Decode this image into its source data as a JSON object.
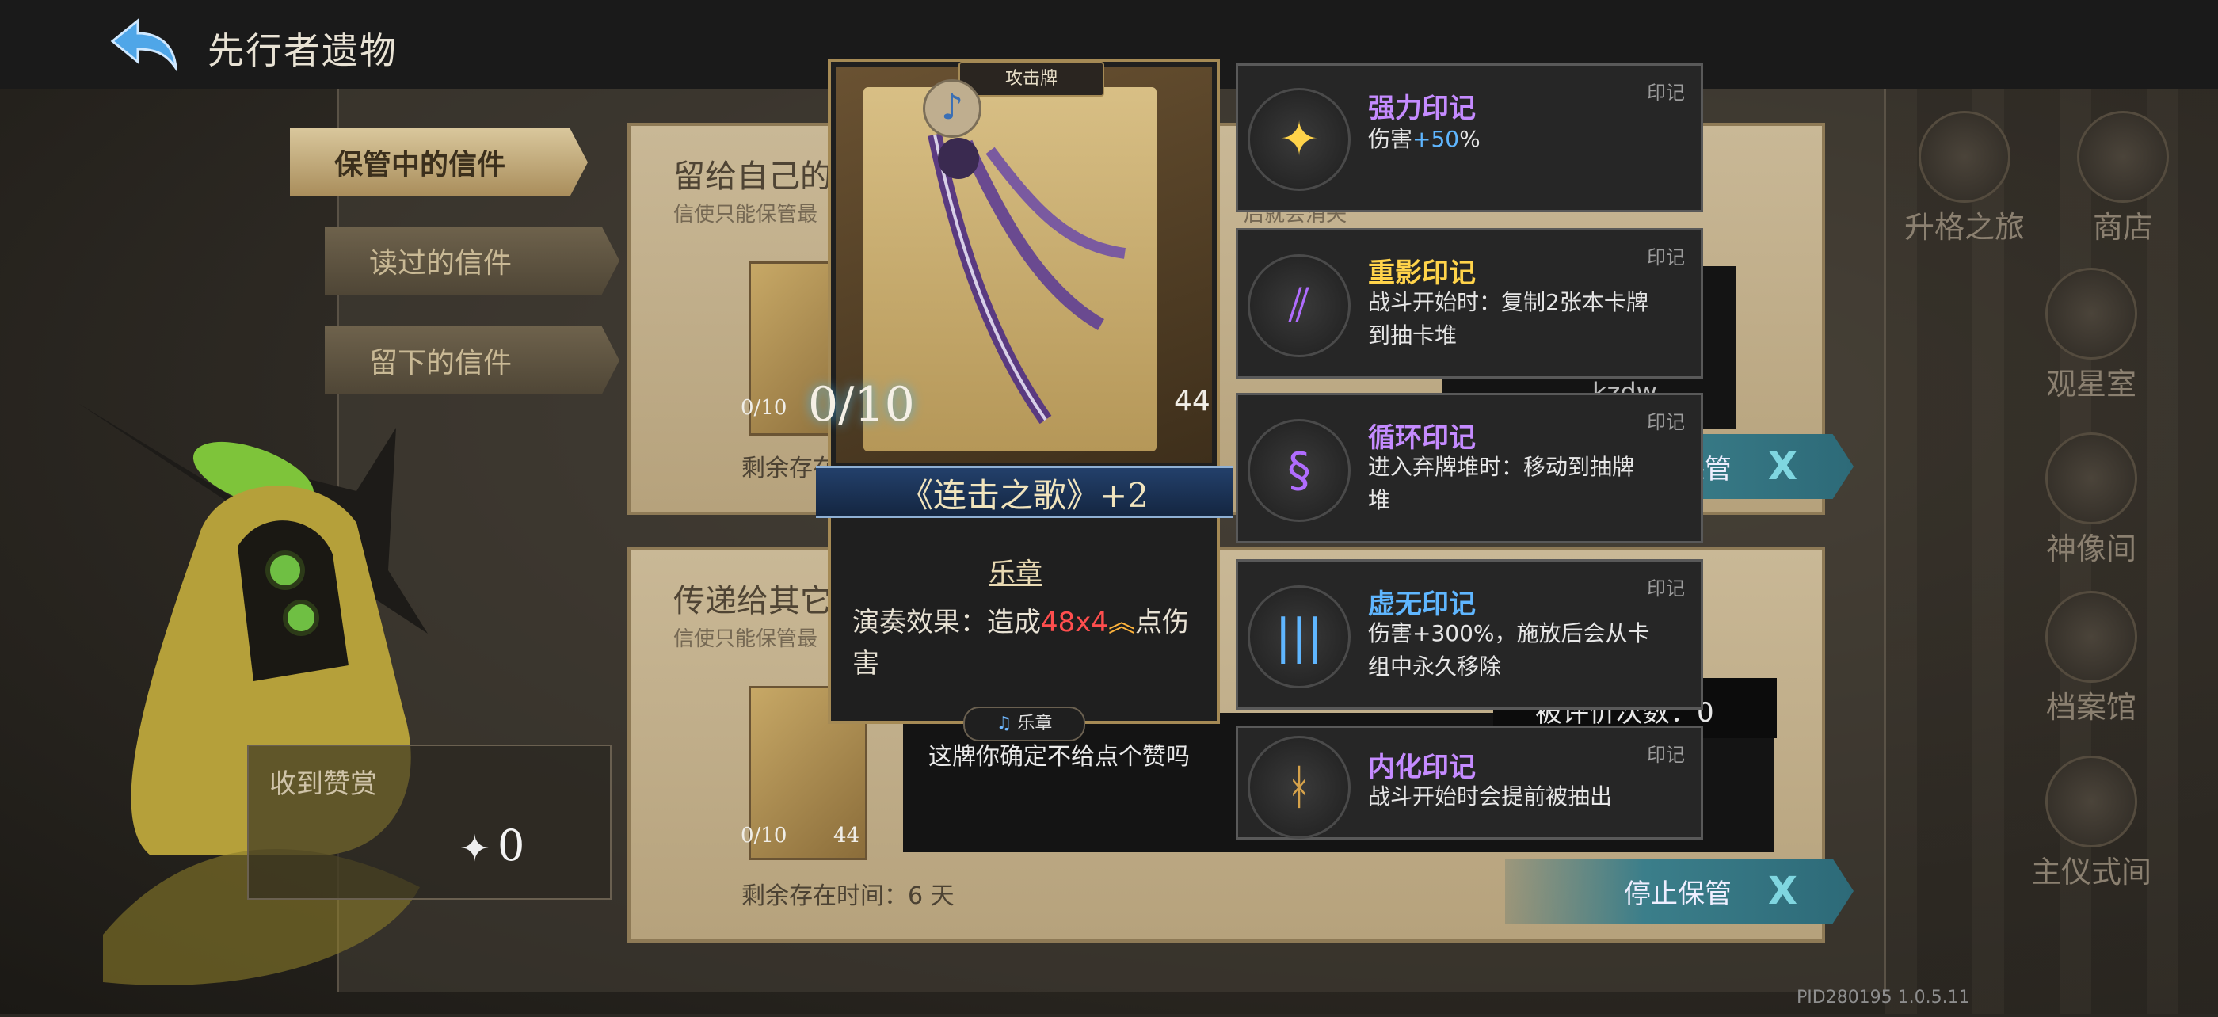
{
  "header": {
    "title": "先行者遗物"
  },
  "tabs": [
    {
      "label": "保管中的信件"
    },
    {
      "label": "读过的信件"
    },
    {
      "label": "留下的信件"
    }
  ],
  "reward": {
    "label": "收到赞赏",
    "count": "0"
  },
  "letters": [
    {
      "title": "留给自己的",
      "subtitle": "信使只能保管最",
      "subtitle_tail": "后就会消失",
      "mini_card_energy": "0/10",
      "time_label": "剩余存在",
      "author": "kzdw",
      "stop_label": "停止保管",
      "stop_x": "X"
    },
    {
      "title": "传递给其它",
      "subtitle": "信使只能保管最",
      "mini_card_energy": "0/10",
      "mini_card_cost": "44",
      "time_label": "剩余存在时间：6 天",
      "message": "这牌你确定不给点个赞吗",
      "count_label": "被评价次数：0",
      "stop_label": "停止保管",
      "stop_x": "X"
    }
  ],
  "card": {
    "type": "攻击牌",
    "energy": "0/10",
    "cost": "44",
    "name": "《连击之歌》+2",
    "keyword": "乐章",
    "effect_prefix": "演奏效果：造成",
    "effect_damage": "48x4",
    "effect_suffix": "点伤害",
    "tag": "乐章"
  },
  "imprints": [
    {
      "tag": "印记",
      "title": "强力印记",
      "desc": "伤害",
      "desc_value": "+50",
      "desc_tail": "%",
      "title_color": "#c58bff",
      "icon": "spark-icon"
    },
    {
      "tag": "印记",
      "title": "重影印记",
      "desc": "战斗开始时：复制2张本卡牌到抽卡堆",
      "title_color": "#ffd34a",
      "icon": "double-slash-icon"
    },
    {
      "tag": "印记",
      "title": "循环印记",
      "desc": "进入弃牌堆时：移动到抽牌堆",
      "title_color": "#c58bff",
      "icon": "swirl-icon"
    },
    {
      "tag": "印记",
      "title": "虚无印记",
      "desc": "伤害+300%，施放后会从卡组中永久移除",
      "title_color": "#5fb6ff",
      "icon": "bars-icon"
    },
    {
      "tag": "印记",
      "title": "内化印记",
      "desc": "战斗开始时会提前被抽出",
      "title_color": "#c58bff",
      "icon": "rune-icon"
    }
  ],
  "nav": [
    {
      "label": "升格之旅",
      "icon": "compass-icon"
    },
    {
      "label": "商店",
      "icon": "shop-icon"
    },
    {
      "label": "观星室",
      "icon": "star-icon"
    },
    {
      "label": "神像间",
      "icon": "statue-icon"
    },
    {
      "label": "档案馆",
      "icon": "archive-icon"
    },
    {
      "label": "主仪式间",
      "icon": "ritual-icon"
    }
  ],
  "version": "PID280195  1.0.5.11",
  "colors": {
    "accent_teal": "#3b7e8a",
    "damage_red": "#ff4e4e",
    "gold": "#a58a55"
  }
}
